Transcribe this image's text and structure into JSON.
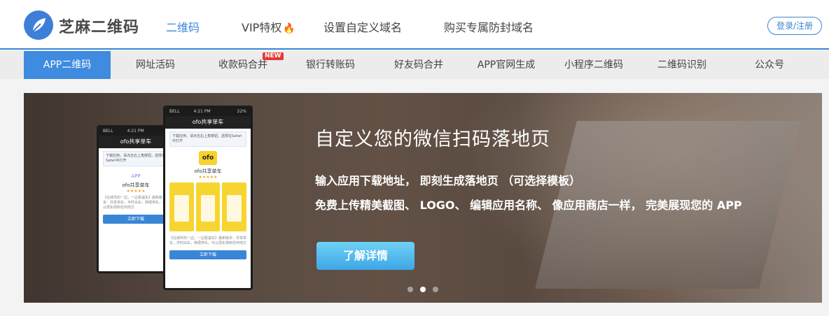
{
  "header": {
    "brand": "芝麻二维码",
    "nav": [
      {
        "label": "二维码",
        "active": true
      },
      {
        "label": "VIP特权",
        "badge_icon": "flame-icon"
      },
      {
        "label": "设置自定义域名"
      },
      {
        "label": "购买专属防封域名"
      }
    ],
    "login_label": "登录/注册"
  },
  "subnav": {
    "items": [
      {
        "label": "APP二维码",
        "active": true
      },
      {
        "label": "网址活码"
      },
      {
        "label": "收款码合并",
        "badge": "NEW"
      },
      {
        "label": "银行转账码"
      },
      {
        "label": "好友码合并"
      },
      {
        "label": "APP官网生成"
      },
      {
        "label": "小程序二维码"
      },
      {
        "label": "二维码识别"
      },
      {
        "label": "公众号"
      }
    ]
  },
  "banner": {
    "headline": "自定义您的微信扫码落地页",
    "line1": "输入应用下载地址， 即刻生成落地页 （可选择模板）",
    "line2": "免费上传精美截图、 LOGO、 编辑应用名称、 像应用商店一样， 完美展现您的 APP",
    "cta_label": "了解详情",
    "slides": 3,
    "active_slide": 2,
    "phone_back": {
      "status": "BELL",
      "time": "4:21 PM",
      "title": "ofo共享单车",
      "notice": "下载应用，请点击右上角按钮，选择在Safari中打开",
      "app_label": "APP",
      "app_name": "ofo共享单车",
      "stars": "★★★★★",
      "desc": "【在城市的一边，一边看遍车】最新版本：共享单车，平时出车，随便停车，可以把车骑到任何地方",
      "download": "立即下载"
    },
    "phone_front": {
      "status": "BELL",
      "time": "4:21 PM",
      "battery": "22%",
      "title": "ofo共享单车",
      "notice": "下载应用，请点击右上角按钮，选择在Safari中打开",
      "logo_text": "ofo",
      "app_name": "ofo共享单车",
      "stars": "★★★★★",
      "desc": "【在城市的一边，一边看遍车】最新版本：共享单车，平时出车，随便停车，可以把车骑到任何地方",
      "download": "立即下载"
    }
  },
  "colors": {
    "accent": "#3a86d6",
    "subnav_active": "#3e8be0",
    "cta_top": "#6fd2f5",
    "cta_bottom": "#3ea6e6",
    "badge": "#e53935"
  }
}
